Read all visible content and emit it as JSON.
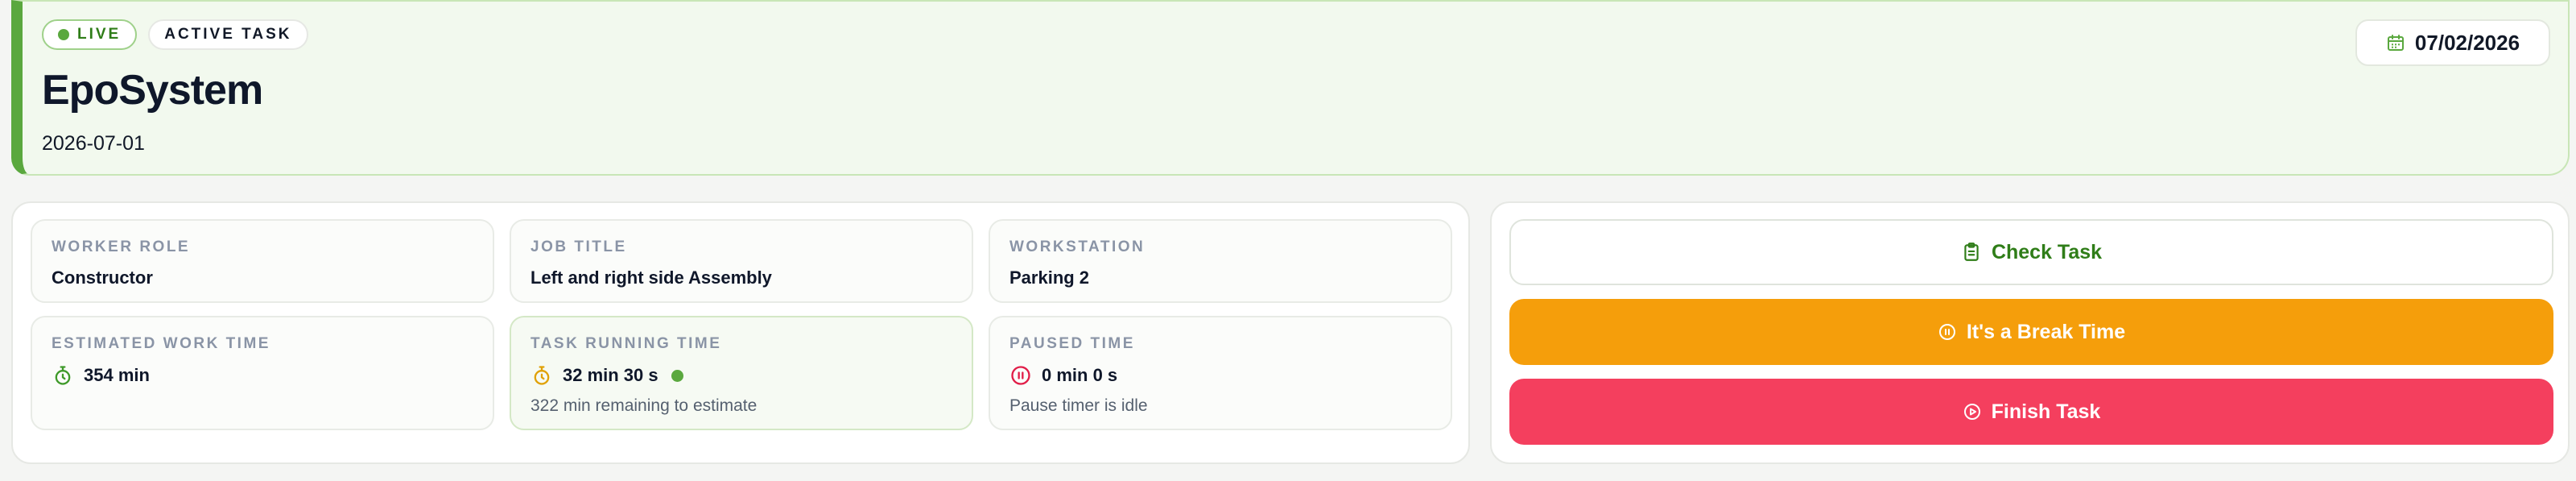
{
  "header": {
    "live_label": "LIVE",
    "active_label": "ACTIVE TASK",
    "title": "EpoSystem",
    "subtitle": "2026-07-01",
    "date": "07/02/2026"
  },
  "cards": {
    "worker_role": {
      "label": "WORKER ROLE",
      "value": "Constructor"
    },
    "job_title": {
      "label": "JOB TITLE",
      "value": "Left and right side Assembly"
    },
    "workstation": {
      "label": "WORKSTATION",
      "value": "Parking 2"
    },
    "estimated": {
      "label": "ESTIMATED WORK TIME",
      "value": "354 min"
    },
    "running": {
      "label": "TASK RUNNING TIME",
      "value": "32 min 30 s",
      "note": "322 min remaining to estimate"
    },
    "paused": {
      "label": "PAUSED TIME",
      "value": "0 min 0 s",
      "note": "Pause timer is idle"
    }
  },
  "actions": {
    "check": "Check Task",
    "break": "It's a Break Time",
    "finish": "Finish Task"
  },
  "colors": {
    "accent_green": "#5aa83e",
    "break_orange": "#f59e0b",
    "finish_red": "#f43f5e"
  },
  "icons": [
    "calendar-icon",
    "stopwatch-icon",
    "pause-circle-icon",
    "clipboard-icon",
    "play-circle-icon"
  ]
}
